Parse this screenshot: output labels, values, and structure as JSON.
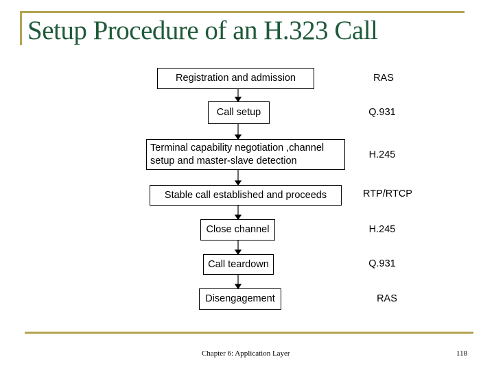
{
  "slide": {
    "title": "Setup Procedure of an H.323 Call",
    "accent_color": "#b3a452",
    "title_color": "#1f5a3a"
  },
  "flow": {
    "steps": [
      {
        "label": "Registration and admission",
        "protocol": "RAS"
      },
      {
        "label": "Call setup",
        "protocol": "Q.931"
      },
      {
        "label": "Terminal capability negotiation ,channel setup and master-slave detection",
        "protocol": "H.245"
      },
      {
        "label": "Stable call established and proceeds",
        "protocol": "RTP/RTCP"
      },
      {
        "label": "Close channel",
        "protocol": "H.245"
      },
      {
        "label": "Call teardown",
        "protocol": "Q.931"
      },
      {
        "label": "Disengagement",
        "protocol": "RAS"
      }
    ]
  },
  "footer": {
    "chapter": "Chapter 6: Application Layer",
    "page_number": "118"
  }
}
